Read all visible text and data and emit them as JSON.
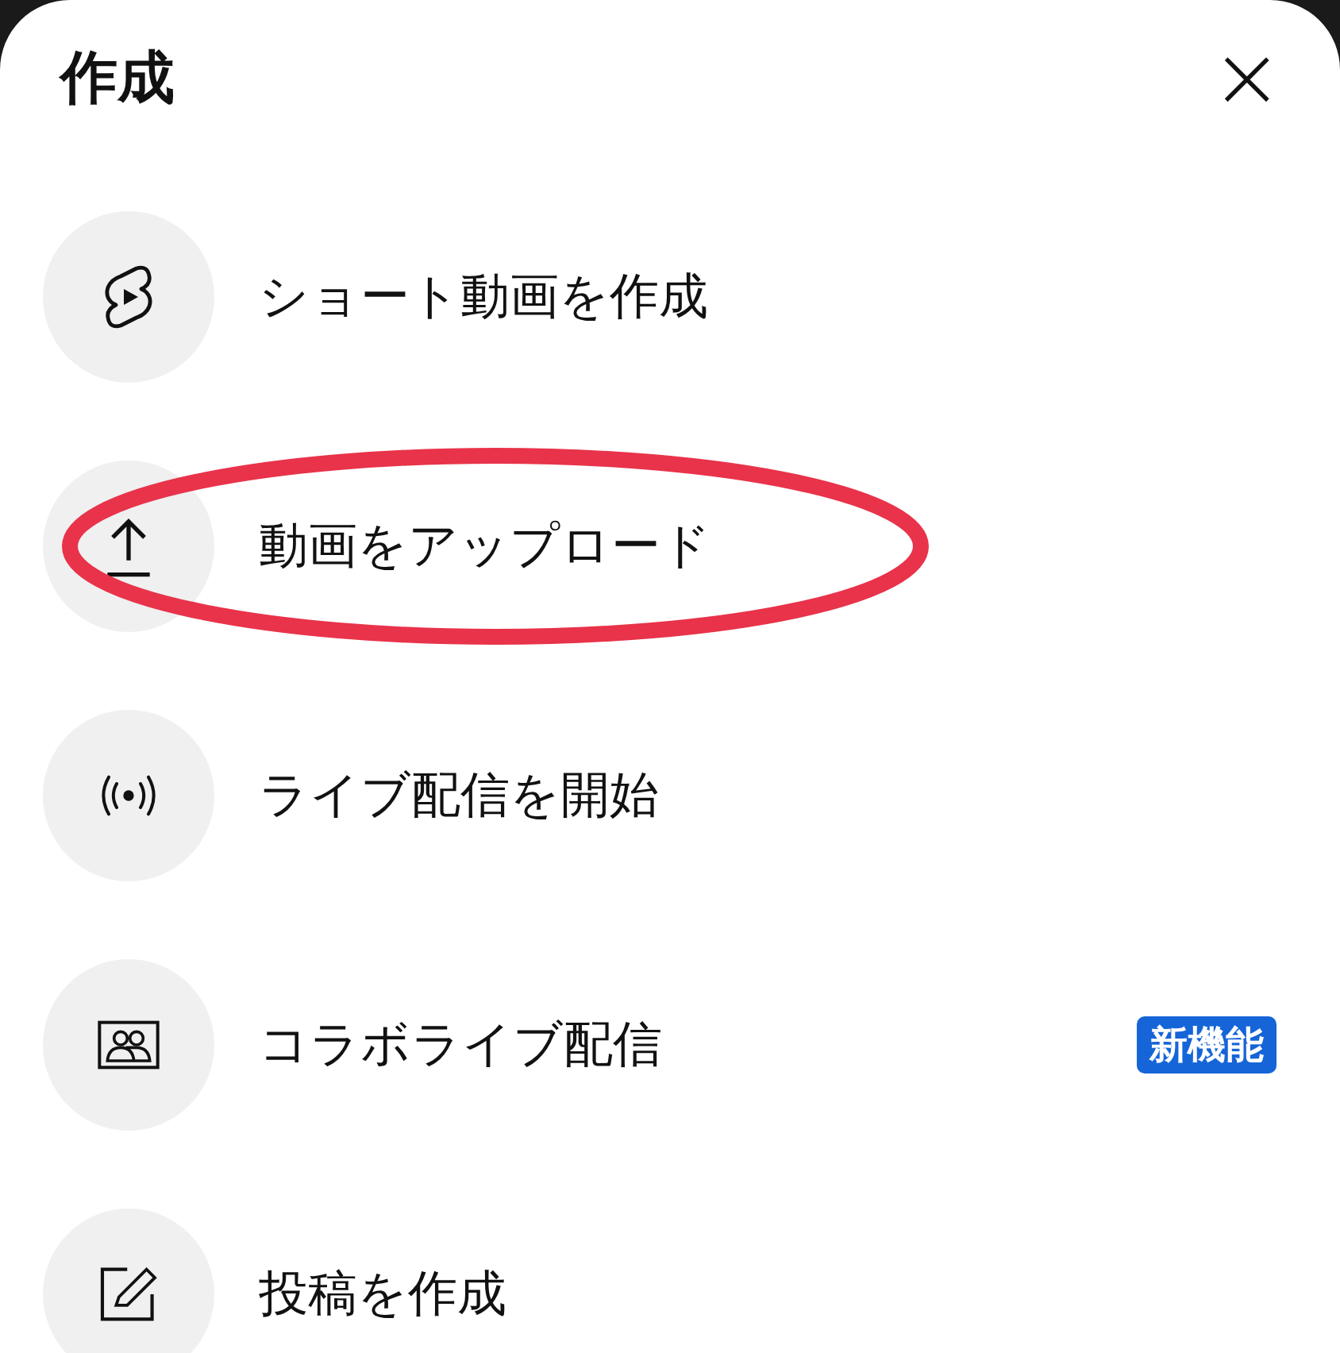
{
  "sheet": {
    "title": "作成",
    "close": "×"
  },
  "items": [
    {
      "kind": "shorts",
      "label": "ショート動画を作成",
      "highlighted": false
    },
    {
      "kind": "upload",
      "label": "動画をアップロード",
      "highlighted": true
    },
    {
      "kind": "live",
      "label": "ライブ配信を開始",
      "highlighted": false
    },
    {
      "kind": "collab",
      "label": "コラボライブ配信",
      "badge": "新機能",
      "highlighted": false
    },
    {
      "kind": "post",
      "label": "投稿を作成",
      "highlighted": false
    }
  ]
}
